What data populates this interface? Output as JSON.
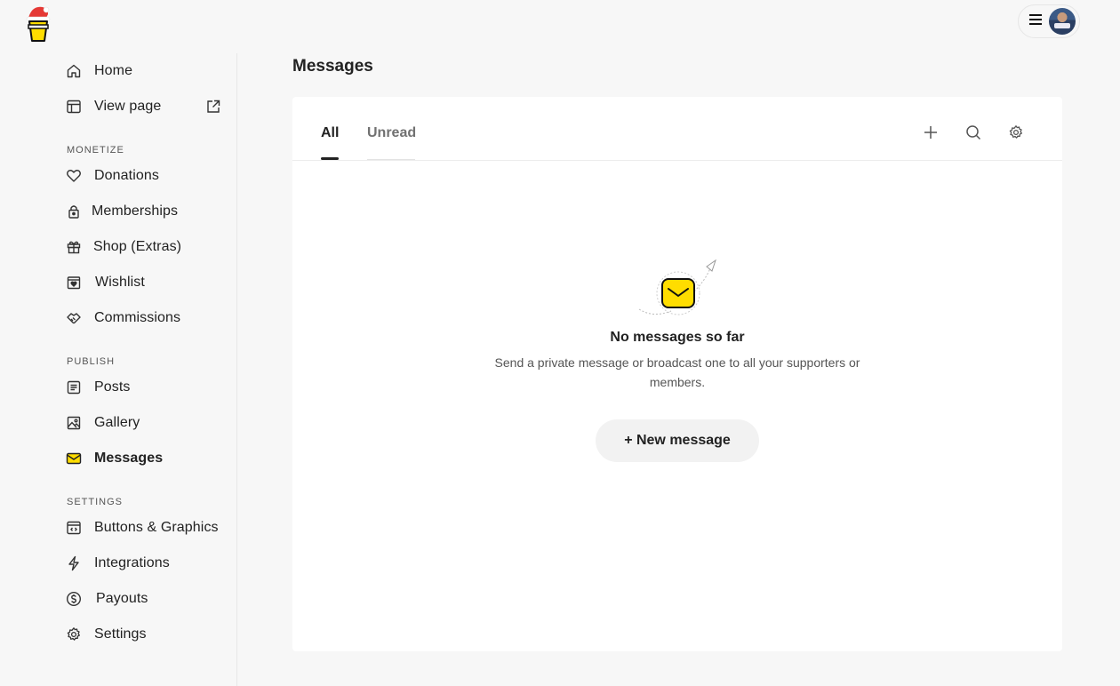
{
  "brand": {
    "logo_icon": "buy-me-a-coffee-cup-santa-hat-icon"
  },
  "user_menu": {
    "menu_icon": "hamburger-icon",
    "avatar_icon": "user-avatar"
  },
  "sidebar": {
    "top_items": [
      {
        "label": "Home",
        "icon": "home-icon"
      },
      {
        "label": "View page",
        "icon": "layout-icon",
        "extra_icon": "external-link-icon"
      }
    ],
    "sections": [
      {
        "label": "MONETIZE",
        "items": [
          {
            "label": "Donations",
            "icon": "heart-icon"
          },
          {
            "label": "Memberships",
            "icon": "lock-icon"
          },
          {
            "label": "Shop (Extras)",
            "icon": "gift-icon"
          },
          {
            "label": "Wishlist",
            "icon": "wishlist-icon"
          },
          {
            "label": "Commissions",
            "icon": "commissions-icon"
          }
        ]
      },
      {
        "label": "PUBLISH",
        "items": [
          {
            "label": "Posts",
            "icon": "document-icon"
          },
          {
            "label": "Gallery",
            "icon": "image-icon"
          },
          {
            "label": "Messages",
            "icon": "envelope-icon",
            "active": true
          }
        ]
      },
      {
        "label": "SETTINGS",
        "items": [
          {
            "label": "Buttons & Graphics",
            "icon": "code-window-icon"
          },
          {
            "label": "Integrations",
            "icon": "lightning-icon"
          },
          {
            "label": "Payouts",
            "icon": "dollar-circle-icon"
          },
          {
            "label": "Settings",
            "icon": "gear-icon"
          }
        ]
      }
    ]
  },
  "main": {
    "title": "Messages",
    "tabs": [
      {
        "label": "All",
        "active": true
      },
      {
        "label": "Unread",
        "active": false
      }
    ],
    "toolbar": {
      "add_icon": "plus-icon",
      "search_icon": "search-icon",
      "settings_icon": "gear-icon"
    },
    "empty_state": {
      "illustration": "envelope-paper-plane-icon",
      "title": "No messages so far",
      "description": "Send a private message or broadcast one to all your supporters or members.",
      "button_label": "+ New message"
    }
  },
  "colors": {
    "accent": "#FFDD00",
    "background": "#f7f7f7",
    "card": "#ffffff",
    "text": "#222222"
  }
}
